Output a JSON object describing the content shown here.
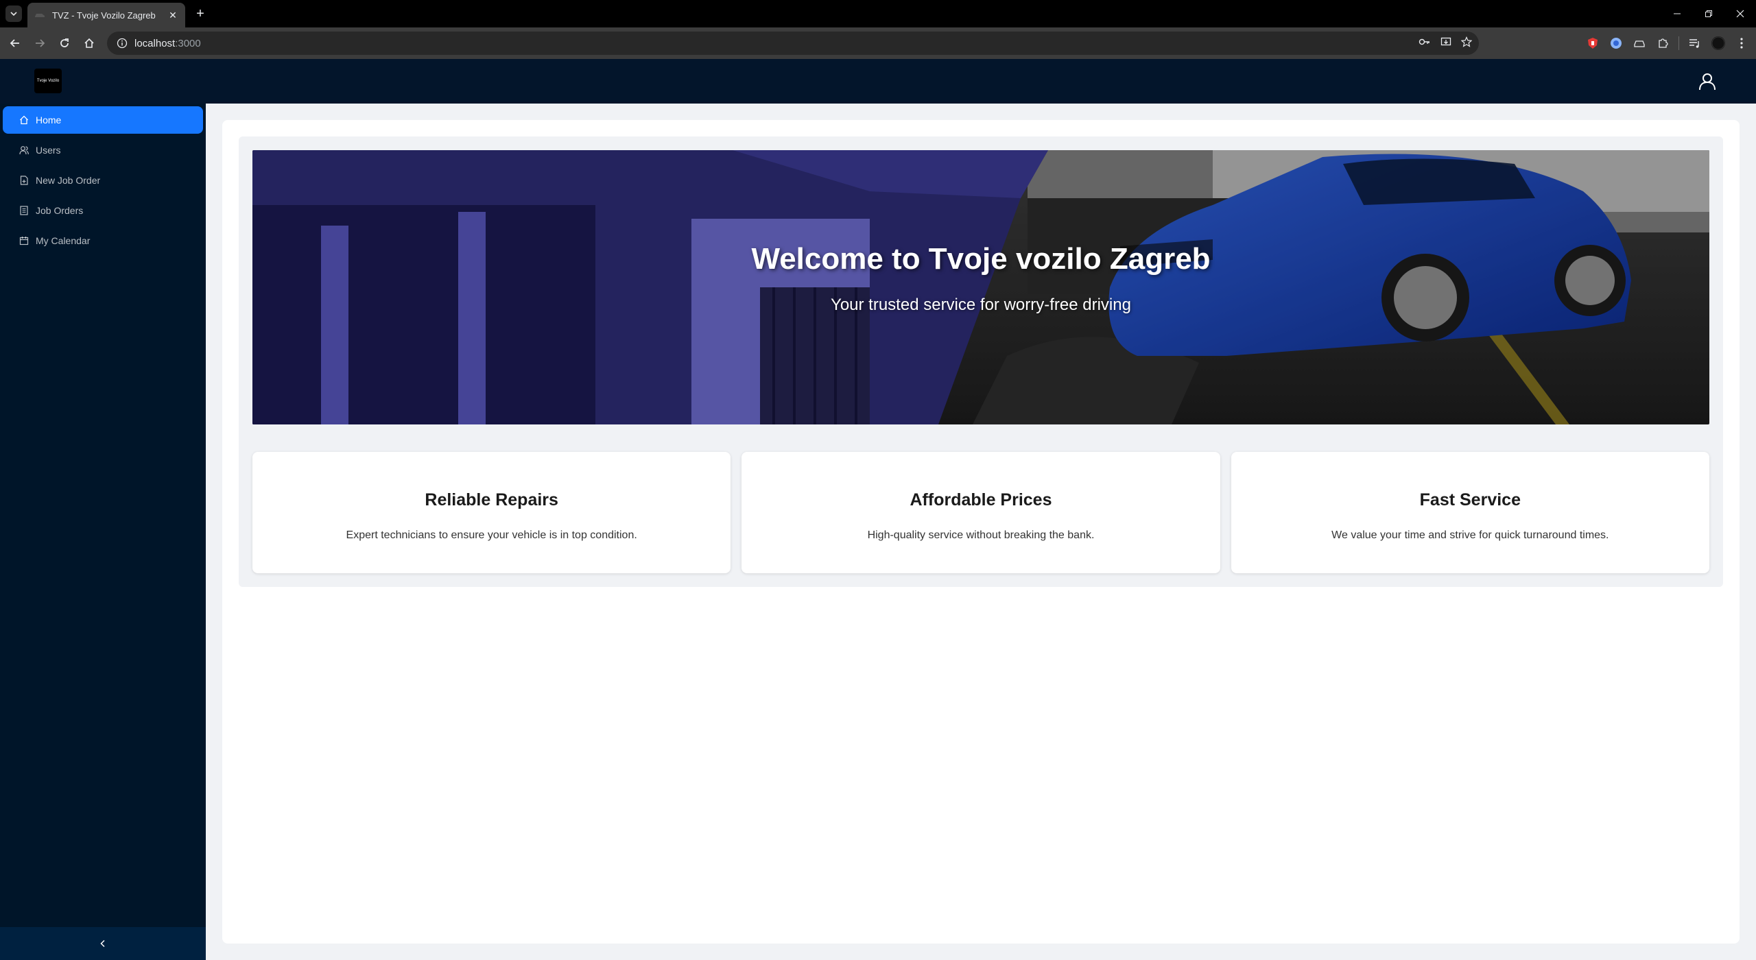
{
  "browser": {
    "tab_title": "TVZ - Tvoje Vozilo Zagreb",
    "url_host": "localhost",
    "url_port": ":3000"
  },
  "header": {
    "logo_text": "Tvoje Vozilo"
  },
  "sidebar": {
    "items": [
      {
        "label": "Home",
        "icon": "home-icon"
      },
      {
        "label": "Users",
        "icon": "users-icon"
      },
      {
        "label": "New Job Order",
        "icon": "file-add-icon"
      },
      {
        "label": "Job Orders",
        "icon": "list-icon"
      },
      {
        "label": "My Calendar",
        "icon": "calendar-icon"
      }
    ],
    "active_index": 0
  },
  "hero": {
    "title": "Welcome to Tvoje vozilo Zagreb",
    "subtitle": "Your trusted service for worry-free driving"
  },
  "cards": [
    {
      "title": "Reliable Repairs",
      "text": "Expert technicians to ensure your vehicle is in top condition."
    },
    {
      "title": "Affordable Prices",
      "text": "High-quality service without breaking the bank."
    },
    {
      "title": "Fast Service",
      "text": "We value your time and strive for quick turnaround times."
    }
  ],
  "colors": {
    "header_bg": "#03152b",
    "sidebar_bg": "#001529",
    "active_item": "#1677ff"
  }
}
